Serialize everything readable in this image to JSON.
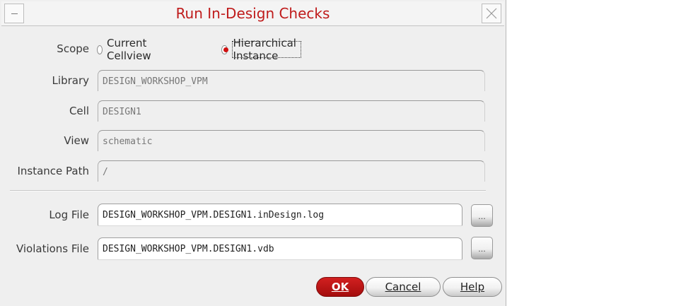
{
  "window": {
    "title": "Run In-Design Checks"
  },
  "scope": {
    "label": "Scope",
    "options": [
      {
        "label": "Current Cellview",
        "selected": false
      },
      {
        "label": "Hierarchical Instance",
        "selected": true
      }
    ]
  },
  "fields": {
    "library": {
      "label": "Library",
      "value": "DESIGN_WORKSHOP_VPM"
    },
    "cell": {
      "label": "Cell",
      "value": "DESIGN1"
    },
    "view": {
      "label": "View",
      "value": "schematic"
    },
    "instance_path": {
      "label": "Instance Path",
      "value": "/"
    },
    "log_file": {
      "label": "Log File",
      "value": "DESIGN_WORKSHOP_VPM.DESIGN1.inDesign.log"
    },
    "violations_file": {
      "label": "Violations File",
      "value": "DESIGN_WORKSHOP_VPM.DESIGN1.vdb"
    }
  },
  "browse_label": "...",
  "buttons": {
    "ok": "OK",
    "cancel": "Cancel",
    "help": "Help"
  },
  "colors": {
    "title": "#bf1b1b",
    "ok_button": "#c01616",
    "radio_selected": "#d01010"
  }
}
